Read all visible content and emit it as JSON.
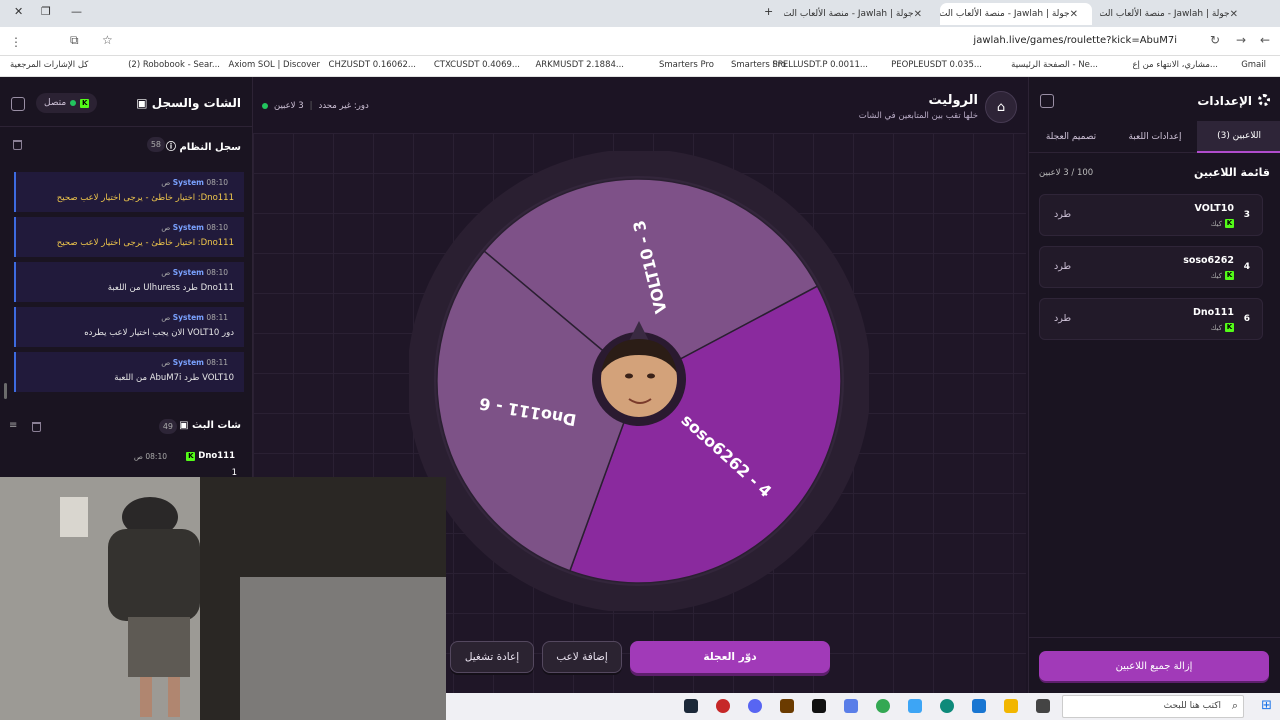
{
  "browser": {
    "tabs": [
      {
        "label": "جولة | Jawlah - منصة الألعاب الت",
        "active": false
      },
      {
        "label": "جولة | Jawlah - منصة الألعاب الت",
        "active": true
      },
      {
        "label": "جولة | Jawlah - منصة الألعاب الت",
        "active": false
      },
      {
        "label": "جولة | Jawlah - منصة الألعاب الت",
        "active": false
      }
    ],
    "url": "jawlah.live/games/roulette?kick=AbuM7i",
    "bookmarks": [
      "Gmail",
      "مشاري، الانتهاء من إع...",
      "الصفحة الرئيسية - Ne...",
      "PEOPLEUSDT 0.035...",
      "SPELLUSDT.P 0.0011...",
      "Smarters Pro",
      "Smarters Pro",
      "ARKMUSDT 2.1884...",
      "CTXCUSDT 0.4069...",
      "CHZUSDT 0.16062...",
      "Axiom SOL | Discover",
      "(2) Robobook - Sear...",
      "كل الإشارات المرجعية"
    ]
  },
  "left_panel": {
    "title": "الشات والسجل",
    "status": "متصل",
    "system_log": {
      "title": "سجل النظام",
      "count": "58",
      "messages": [
        {
          "sender": "System",
          "time": "08:10 ص",
          "text": "Dno111: اختيار خاطئ - يرجى اختيار لاعب صحيح",
          "warn": true
        },
        {
          "sender": "System",
          "time": "08:10 ص",
          "text": "Dno111: اختيار خاطئ - يرجى اختيار لاعب صحيح",
          "warn": true
        },
        {
          "sender": "System",
          "time": "08:10 ص",
          "text": "Dno111 طرد Ulhuress من اللعبة",
          "warn": false
        },
        {
          "sender": "System",
          "time": "08:11 ص",
          "text": "دور VOLT10 الان يجب اختيار لاعب يطرده",
          "warn": false
        },
        {
          "sender": "System",
          "time": "08:11 ص",
          "text": "VOLT10 طرد AbuM7i من اللعبة",
          "warn": false
        }
      ]
    },
    "stream_chat": {
      "title": "شات البث",
      "count": "49",
      "message": {
        "user": "Dno111",
        "time": "08:10 ص",
        "text": "1"
      }
    }
  },
  "center": {
    "title": "الروليت",
    "subtitle": "خلها تقب بين المتابعين في الشات",
    "players_online": "3 لاعبين",
    "turn": "دور: غير محدد",
    "wheel": {
      "segments": [
        {
          "label": "VOLT10 - 3",
          "color": "#7e5188"
        },
        {
          "label": "soso6262 - 4",
          "color": "#8a2a9e"
        },
        {
          "label": "Dno111 - 6",
          "color": "#7d5287"
        }
      ]
    },
    "buttons": {
      "spin": "دوّر العجلة",
      "add_player": "إضافة لاعب",
      "restart": "إعادة تشغيل"
    }
  },
  "right_panel": {
    "title": "الإعدادات",
    "tabs": [
      "اللاعبين (3)",
      "إعدادات اللعبة",
      "تصميم العجلة"
    ],
    "players_title": "قائمة اللاعبين",
    "players_count": "100 / 3 لاعبين",
    "players": [
      {
        "num": "3",
        "name": "VOLT10",
        "platform": "كيك",
        "action": "طرد"
      },
      {
        "num": "4",
        "name": "soso6262",
        "platform": "كيك",
        "action": "طرد"
      },
      {
        "num": "6",
        "name": "Dno111",
        "platform": "كيك",
        "action": "طرد"
      }
    ],
    "remove_all": "إزالة جميع اللاعبين"
  },
  "taskbar": {
    "search_placeholder": "اكتب هنا للبحث"
  }
}
